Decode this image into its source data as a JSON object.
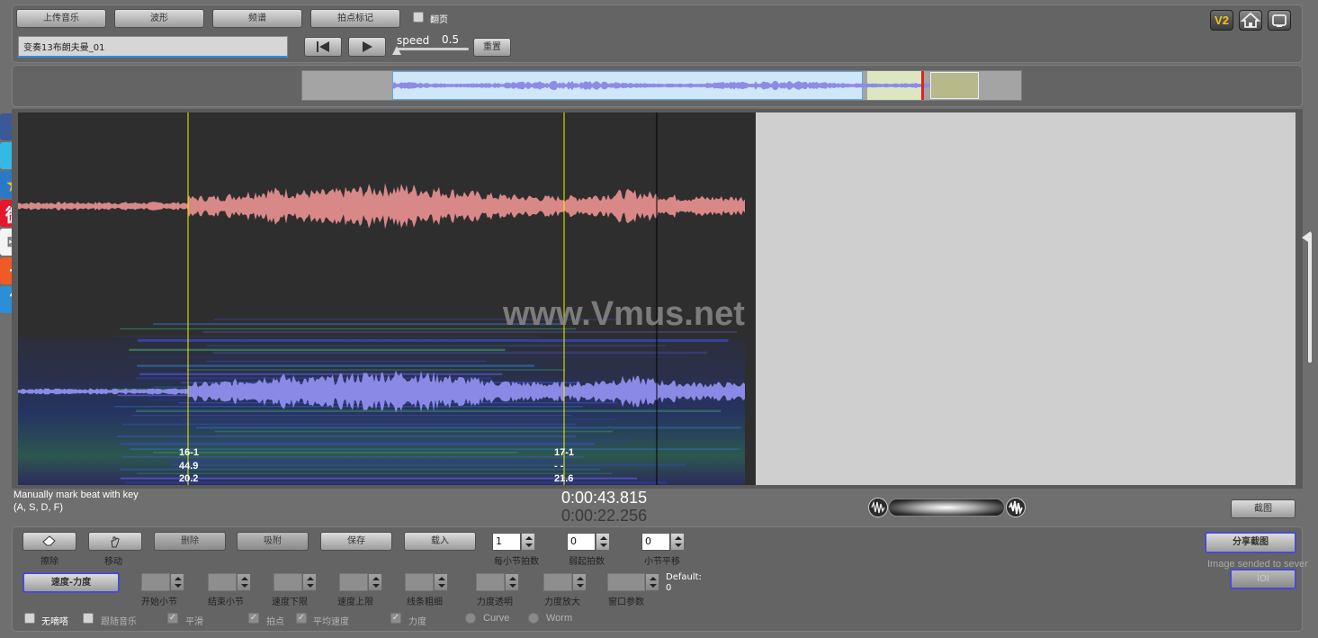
{
  "toolbar": {
    "upload_label": "上传音乐",
    "waveform_label": "波形",
    "spectrum_label": "频谱",
    "beat_mark_label": "拍点标记",
    "page_flip_label": "翻页",
    "track_name": "变奏13布朗夫曼_01",
    "speed_label": "speed",
    "speed_value": "0.5",
    "reset_label": "重置",
    "speed_slider_fraction": 0.0
  },
  "top_icons": {
    "version_label": "V2",
    "home_icon": "home-icon",
    "fullscreen_icon": "screen-icon"
  },
  "overview": {
    "viewport_start": 0.125,
    "viewport_end": 0.78,
    "playhead": 0.861
  },
  "social": [
    {
      "name": "facebook",
      "glyph": "f",
      "color": "#3b5998"
    },
    {
      "name": "twitter",
      "glyph": "t",
      "color": "#33b9e5"
    },
    {
      "name": "favorite",
      "glyph": "★",
      "color": "#2a79c9"
    },
    {
      "name": "weibo",
      "glyph": "微",
      "color": "#e6162d"
    },
    {
      "name": "email",
      "glyph": "✉",
      "color": "#f4f4f4"
    },
    {
      "name": "add",
      "glyph": "+",
      "color": "#f05a24"
    },
    {
      "name": "help",
      "glyph": "?",
      "color": "#2a8fd6"
    }
  ],
  "viewer": {
    "watermark": "www.Vmus.net",
    "markers": [
      {
        "bar": "16-1",
        "value1": "44.9",
        "value2": "20.2"
      },
      {
        "bar": "17-1",
        "value1": "- -",
        "value2": "21.6"
      }
    ]
  },
  "status": {
    "hint_line1": "Manually mark beat with key",
    "hint_line2": "(A, S, D, F)",
    "time_current": "0:00:43.815",
    "time_total": "0:00:22.256",
    "screenshot_label": "截图"
  },
  "controls": {
    "erase_label": "擦除",
    "move_label": "移动",
    "delete_label": "删除",
    "snap_label": "吸附",
    "save_label": "保存",
    "load_label": "载入",
    "beats_per_bar_value": "1",
    "beats_per_bar_label": "每小节拍数",
    "pickup_value": "0",
    "pickup_label": "弱起拍数",
    "bar_shift_value": "0",
    "bar_shift_label": "小节平移",
    "speed_force_label": "速度-力度",
    "start_bar_label": "开始小节",
    "end_bar_label": "结束小节",
    "speed_lower_label": "速度下限",
    "speed_upper_label": "速度上限",
    "line_width_label": "线条粗细",
    "force_transparency_label": "力度透明",
    "force_zoom_label": "力度放大",
    "window_param_label": "窗口参数",
    "default_label": "Default:",
    "default_value": "0",
    "no_metronome_label": "无嘀嗒",
    "follow_music_label": "跟随音乐",
    "smooth_label": "平滑",
    "beat_point_label": "拍点",
    "avg_speed_label": "平均速度",
    "force_label": "力度",
    "curve_label": "Curve",
    "worm_label": "Worm",
    "share_label": "分享截图",
    "image_sent_label": "Image sended to sever",
    "ok_label": "IOI"
  }
}
